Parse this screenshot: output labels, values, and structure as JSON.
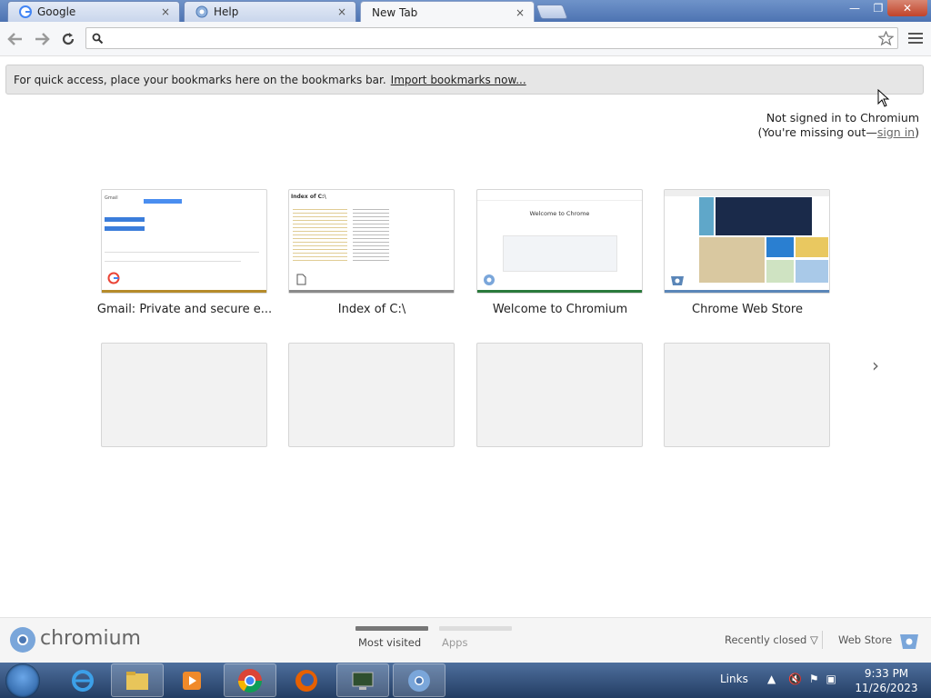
{
  "tabs": [
    {
      "label": "Google",
      "icon": "google-icon"
    },
    {
      "label": "Help",
      "icon": "chrome-help-icon"
    },
    {
      "label": "New Tab",
      "icon": ""
    }
  ],
  "tab_close": "×",
  "window": {
    "minimize": "—",
    "maximize": "❐",
    "close": "✕"
  },
  "toolbar": {
    "omnibox_value": ""
  },
  "bookmark_bar": {
    "message": "For quick access, place your bookmarks here on the bookmarks bar.",
    "link": "Import bookmarks now..."
  },
  "signin": {
    "line1": "Not signed in to Chromium",
    "line2_prefix": "(You're missing out—",
    "line2_link": "sign in",
    "line2_suffix": ")"
  },
  "most_visited": [
    {
      "label": "Gmail: Private and secure e...",
      "accent": "#b58b2a"
    },
    {
      "label": "Index of C:\\",
      "accent": "#8a8a8a"
    },
    {
      "label": "Welcome to Chromium",
      "accent": "#2a7a3c"
    },
    {
      "label": "Chrome Web Store",
      "accent": "#5a86b8"
    }
  ],
  "thumbs": {
    "gmail_heading": "Gmail",
    "index_heading": "Index of C:\\",
    "welcome_heading": "Welcome to Chrome"
  },
  "next_arrow": "›",
  "footer": {
    "brand": "chromium",
    "tab_most_visited": "Most visited",
    "tab_apps": "Apps",
    "recently_closed": "Recently closed ▽",
    "web_store": "Web Store"
  },
  "taskbar": {
    "links": "Links",
    "time": "9:33 PM",
    "date": "11/26/2023"
  },
  "colors": {
    "accent_blue": "#4d73b2",
    "pager_active": "#777777",
    "pager_inactive": "#dddddd"
  }
}
